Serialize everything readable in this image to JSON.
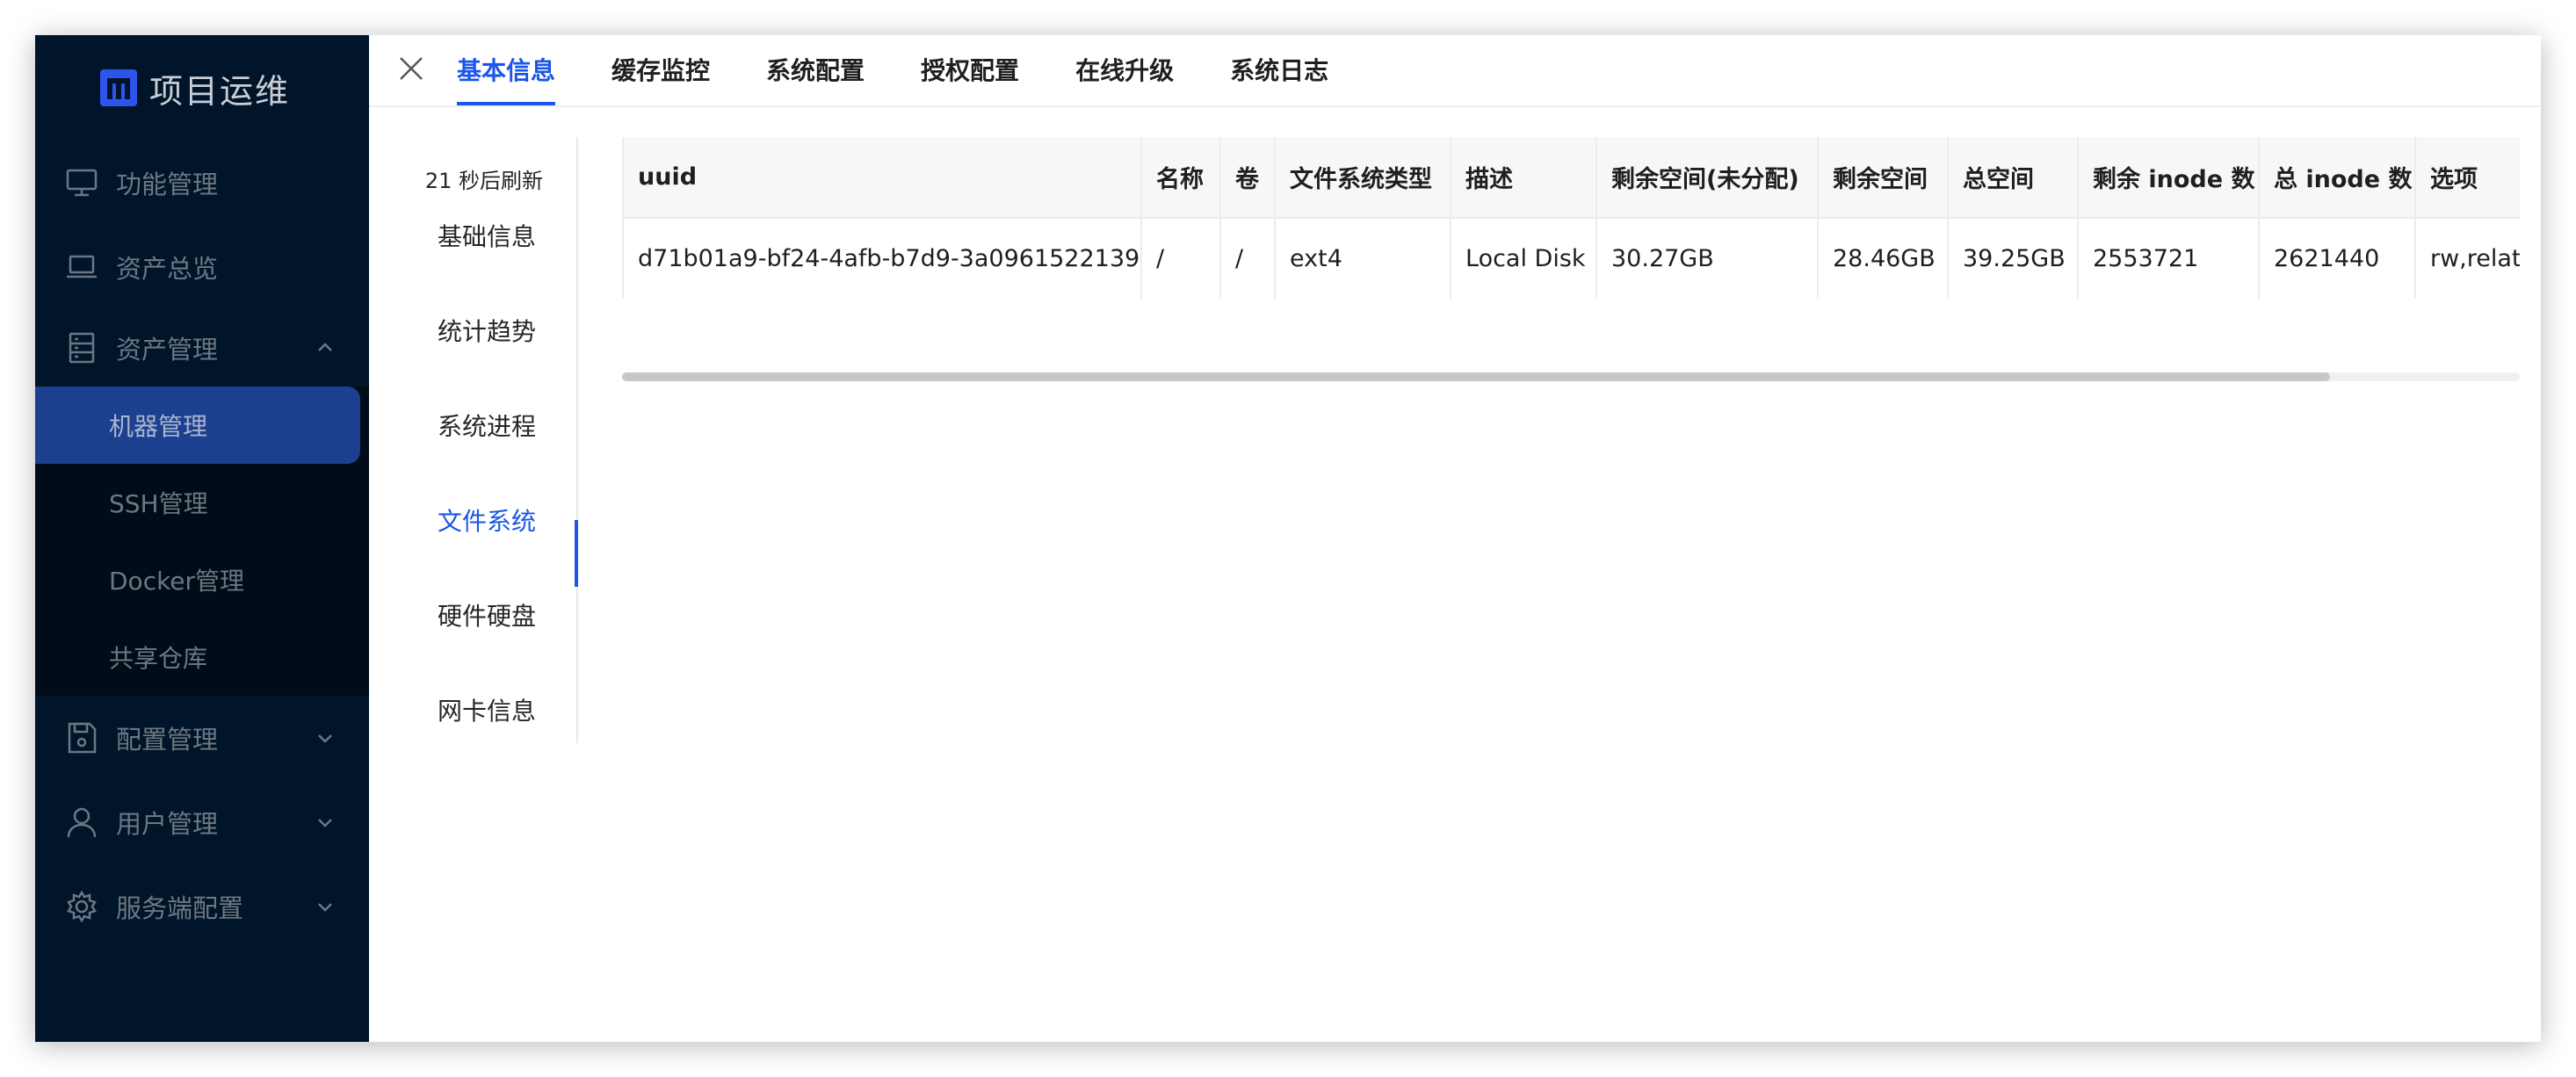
{
  "app": {
    "title": "项目运维"
  },
  "sidebar": {
    "items": [
      {
        "label": "功能管理",
        "icon": "monitor-icon"
      },
      {
        "label": "资产总览",
        "icon": "laptop-icon"
      },
      {
        "label": "资产管理",
        "icon": "database-icon",
        "expanded": true
      },
      {
        "label": "配置管理",
        "icon": "save-icon"
      },
      {
        "label": "用户管理",
        "icon": "user-icon"
      },
      {
        "label": "服务端配置",
        "icon": "gear-icon"
      }
    ],
    "subitems": [
      {
        "label": "机器管理",
        "active": true
      },
      {
        "label": "SSH管理"
      },
      {
        "label": "Docker管理"
      },
      {
        "label": "共享仓库"
      }
    ]
  },
  "tabs": [
    {
      "label": "基本信息",
      "active": true
    },
    {
      "label": "缓存监控"
    },
    {
      "label": "系统配置"
    },
    {
      "label": "授权配置"
    },
    {
      "label": "在线升级"
    },
    {
      "label": "系统日志"
    }
  ],
  "side_panel": {
    "refresh_text": "21 秒后刷新",
    "tabs": [
      {
        "label": "基础信息"
      },
      {
        "label": "统计趋势"
      },
      {
        "label": "系统进程"
      },
      {
        "label": "文件系统",
        "active": true
      },
      {
        "label": "硬件硬盘"
      },
      {
        "label": "网卡信息"
      }
    ]
  },
  "table": {
    "columns": [
      "uuid",
      "名称",
      "卷",
      "文件系统类型",
      "描述",
      "剩余空间(未分配)",
      "剩余空间",
      "总空间",
      "剩余 inode 数",
      "总 inode 数",
      "选项"
    ],
    "rows": [
      [
        "d71b01a9-bf24-4afb-b7d9-3a0961522139",
        "/",
        "/",
        "ext4",
        "Local Disk",
        "30.27GB",
        "28.46GB",
        "39.25GB",
        "2553721",
        "2621440",
        "rw,relatime"
      ]
    ]
  },
  "colors": {
    "sidebar_bg": "#001529",
    "accent": "#1a56e8",
    "active_menu_bg": "#1c3f8f"
  }
}
